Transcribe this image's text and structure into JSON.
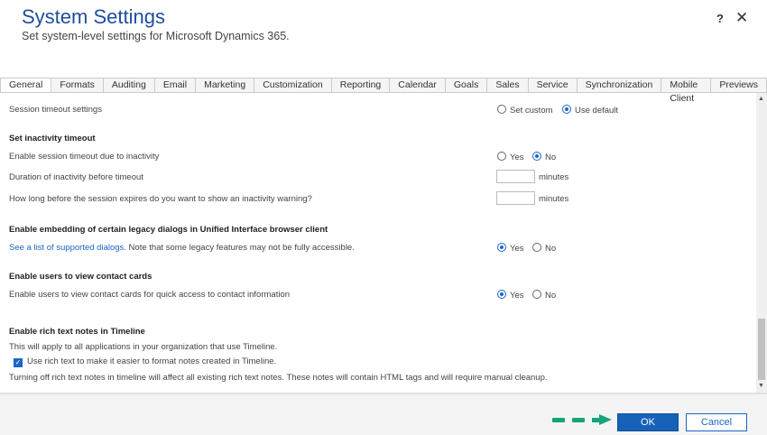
{
  "header": {
    "title": "System Settings",
    "subtitle": "Set system-level settings for Microsoft Dynamics 365.",
    "help": "?",
    "close": "✕"
  },
  "tabs": [
    "General",
    "Formats",
    "Auditing",
    "Email",
    "Marketing",
    "Customization",
    "Reporting",
    "Calendar",
    "Goals",
    "Sales",
    "Service",
    "Synchronization",
    "Mobile Client",
    "Previews"
  ],
  "content": {
    "session_timeout_label": "Session timeout settings",
    "set_custom": "Set custom",
    "use_default": "Use default",
    "inactivity_heading": "Set inactivity timeout",
    "enable_inactivity_label": "Enable session timeout due to inactivity",
    "yes": "Yes",
    "no": "No",
    "duration_label": "Duration of inactivity before timeout",
    "duration_value": "",
    "minutes": "minutes",
    "warning_label": "How long before the session expires do you want to show an inactivity warning?",
    "warning_value": "",
    "legacy_heading": "Enable embedding of certain legacy dialogs in Unified Interface browser client",
    "legacy_link": "See a list of supported dialogs.",
    "legacy_text": " Note that some legacy features may not be fully accessible.",
    "contact_heading": "Enable users to view contact cards",
    "contact_label": "Enable users to view contact cards for quick access to contact information",
    "rich_heading": "Enable rich text notes in Timeline",
    "rich_desc": "This will apply to all applications in your organization that use Timeline.",
    "rich_checkbox": "Use rich text to make it easier to format notes created in Timeline.",
    "rich_warning": "Turning off rich text notes in timeline will affect all existing rich text notes. These notes will contain HTML tags and will require manual cleanup."
  },
  "footer": {
    "ok": "OK",
    "cancel": "Cancel"
  },
  "colors": {
    "accent": "#1662b8",
    "arrow": "#17a37a"
  }
}
